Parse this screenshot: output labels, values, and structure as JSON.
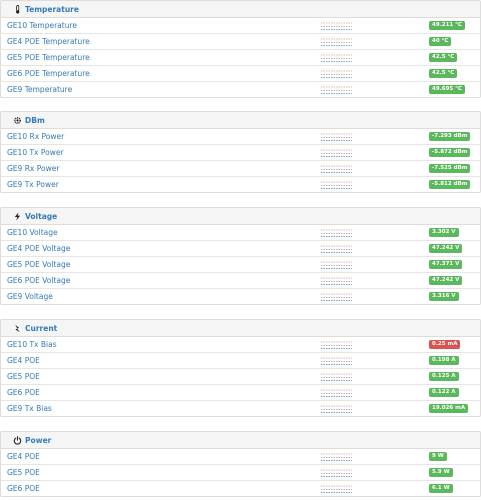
{
  "colors": {
    "ok": "#5cb85c",
    "alert": "#d9534f",
    "link": "#337ab7"
  },
  "sections": [
    {
      "title": "Temperature",
      "icon": "thermometer-icon",
      "rows": [
        {
          "label": "GE10 Temperature",
          "value": "49.211 °C",
          "status": "ok"
        },
        {
          "label": "GE4 POE Temperature",
          "value": "40 °C",
          "status": "ok"
        },
        {
          "label": "GE5 POE Temperature",
          "value": "42.5 °C",
          "status": "ok"
        },
        {
          "label": "GE6 POE Temperature",
          "value": "42.5 °C",
          "status": "ok"
        },
        {
          "label": "GE9 Temperature",
          "value": "49.695 °C",
          "status": "ok"
        }
      ]
    },
    {
      "title": "DBm",
      "icon": "gear-icon",
      "rows": [
        {
          "label": "GE10 Rx Power",
          "value": "-7.293 dBm",
          "status": "ok"
        },
        {
          "label": "GE10 Tx Power",
          "value": "-5.872 dBm",
          "status": "ok"
        },
        {
          "label": "GE9 Rx Power",
          "value": "-7.525 dBm",
          "status": "ok"
        },
        {
          "label": "GE9 Tx Power",
          "value": "-5.812 dBm",
          "status": "ok"
        }
      ]
    },
    {
      "title": "Voltage",
      "icon": "bolt-icon",
      "rows": [
        {
          "label": "GE10 Voltage",
          "value": "3.302 V",
          "status": "ok"
        },
        {
          "label": "GE4 POE Voltage",
          "value": "47.242 V",
          "status": "ok"
        },
        {
          "label": "GE5 POE Voltage",
          "value": "47.371 V",
          "status": "ok"
        },
        {
          "label": "GE6 POE Voltage",
          "value": "47.242 V",
          "status": "ok"
        },
        {
          "label": "GE9 Voltage",
          "value": "3.316 V",
          "status": "ok"
        }
      ]
    },
    {
      "title": "Current",
      "icon": "current-icon",
      "rows": [
        {
          "label": "GE10 Tx Bias",
          "value": "0.25 mA",
          "status": "alert"
        },
        {
          "label": "GE4 POE",
          "value": "0.198 A",
          "status": "ok"
        },
        {
          "label": "GE5 POE",
          "value": "0.125 A",
          "status": "ok"
        },
        {
          "label": "GE6 POE",
          "value": "0.122 A",
          "status": "ok"
        },
        {
          "label": "GE9 Tx Bias",
          "value": "19.026 mA",
          "status": "ok"
        }
      ]
    },
    {
      "title": "Power",
      "icon": "power-icon",
      "rows": [
        {
          "label": "GE4 POE",
          "value": "9 W",
          "status": "ok"
        },
        {
          "label": "GE5 POE",
          "value": "5.9 W",
          "status": "ok"
        },
        {
          "label": "GE6 POE",
          "value": "6.1 W",
          "status": "ok"
        }
      ]
    }
  ]
}
